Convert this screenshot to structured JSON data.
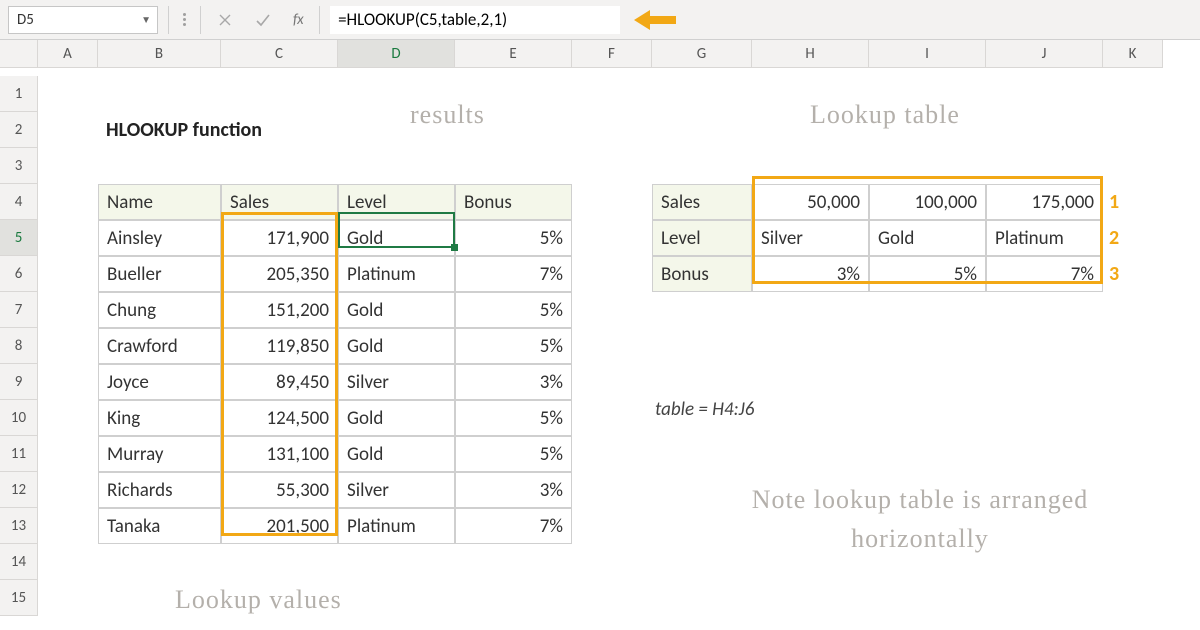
{
  "formula_bar": {
    "cell_ref": "D5",
    "formula": "=HLOOKUP(C5,table,2,1)",
    "fx_label": "fx"
  },
  "columns": [
    "A",
    "B",
    "C",
    "D",
    "E",
    "F",
    "G",
    "H",
    "I",
    "J",
    "K"
  ],
  "rows": [
    "1",
    "2",
    "3",
    "4",
    "5",
    "6",
    "7",
    "8",
    "9",
    "10",
    "11",
    "12",
    "13",
    "14",
    "15"
  ],
  "title": "HLOOKUP function",
  "annotations": {
    "results": "results",
    "lookup_table": "Lookup table",
    "lookup_values": "Lookup values",
    "note": "Note lookup table is arranged horizontally",
    "table_def": "table = H4:J6"
  },
  "headers": {
    "name": "Name",
    "sales": "Sales",
    "level": "Level",
    "bonus": "Bonus"
  },
  "people": [
    {
      "name": "Ainsley",
      "sales": "171,900",
      "level": "Gold",
      "bonus": "5%"
    },
    {
      "name": "Bueller",
      "sales": "205,350",
      "level": "Platinum",
      "bonus": "7%"
    },
    {
      "name": "Chung",
      "sales": "151,200",
      "level": "Gold",
      "bonus": "5%"
    },
    {
      "name": "Crawford",
      "sales": "119,850",
      "level": "Gold",
      "bonus": "5%"
    },
    {
      "name": "Joyce",
      "sales": "89,450",
      "level": "Silver",
      "bonus": "3%"
    },
    {
      "name": "King",
      "sales": "124,500",
      "level": "Gold",
      "bonus": "5%"
    },
    {
      "name": "Murray",
      "sales": "131,100",
      "level": "Gold",
      "bonus": "5%"
    },
    {
      "name": "Richards",
      "sales": "55,300",
      "level": "Silver",
      "bonus": "3%"
    },
    {
      "name": "Tanaka",
      "sales": "201,500",
      "level": "Platinum",
      "bonus": "7%"
    }
  ],
  "lookup": {
    "row_labels": {
      "sales": "Sales",
      "level": "Level",
      "bonus": "Bonus"
    },
    "sales": [
      "50,000",
      "100,000",
      "175,000"
    ],
    "level": [
      "Silver",
      "Gold",
      "Platinum"
    ],
    "bonus": [
      "3%",
      "5%",
      "7%"
    ],
    "row_nums": [
      "1",
      "2",
      "3"
    ]
  }
}
